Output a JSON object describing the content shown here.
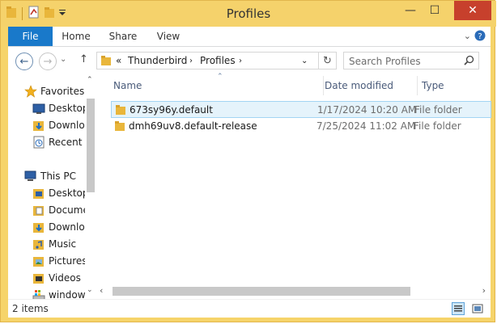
{
  "window": {
    "title": "Profiles",
    "accent": "#f5d26b",
    "controls": {
      "minimize": "minimize-icon",
      "maximize": "maximize-icon",
      "close": "close-icon"
    }
  },
  "ribbon": {
    "tabs": [
      {
        "label": "File",
        "active": true,
        "color": "#1979ca"
      },
      {
        "label": "Home"
      },
      {
        "label": "Share"
      },
      {
        "label": "View"
      }
    ]
  },
  "address": {
    "overflow": "«",
    "crumbs": [
      "Thunderbird",
      "Profiles"
    ],
    "search_placeholder": "Search Profiles"
  },
  "nav": {
    "favorites_label": "Favorites",
    "favorites": [
      "Desktop",
      "Downlo",
      "Recent p"
    ],
    "this_pc_label": "This PC",
    "this_pc": [
      "Desktop",
      "Docume",
      "Downlo",
      "Music",
      "Pictures",
      "Videos",
      "window"
    ]
  },
  "columns": {
    "name": "Name",
    "date": "Date modified",
    "type": "Type"
  },
  "files": [
    {
      "name": "673sy96y.default",
      "date": "1/17/2024 10:20 AM",
      "type": "File folder",
      "selected": true
    },
    {
      "name": "dmh69uv8.default-release",
      "date": "7/25/2024 11:02 AM",
      "type": "File folder",
      "selected": false
    }
  ],
  "status": {
    "item_count": "2 items"
  }
}
